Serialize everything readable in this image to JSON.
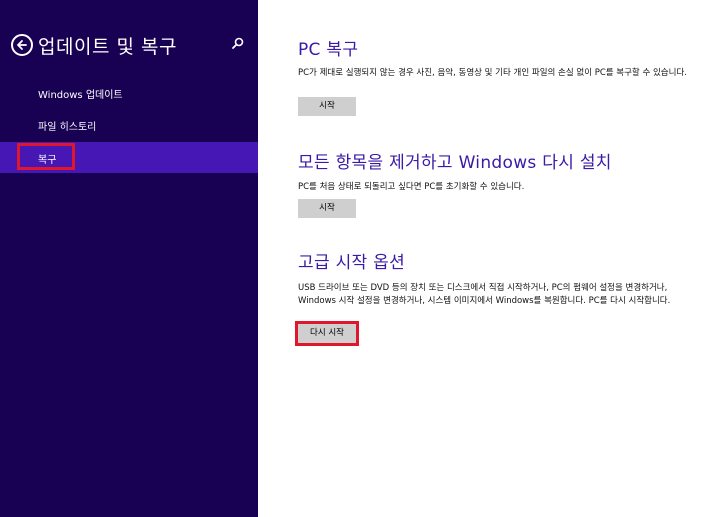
{
  "sidebar": {
    "title": "업데이트 및 복구",
    "items": [
      {
        "label": "Windows 업데이트"
      },
      {
        "label": "파일 히스토리"
      },
      {
        "label": "복구"
      }
    ]
  },
  "main": {
    "sections": [
      {
        "title": "PC 복구",
        "description": "PC가 제대로 실행되지 않는 경우 사진, 음악, 동영상 및 기타 개인 파일의 손실 없이 PC를 복구할 수 있습니다.",
        "button": "시작"
      },
      {
        "title": "모든 항목을 제거하고 Windows 다시 설치",
        "description": "PC를 처음 상태로 되돌리고 싶다면 PC를 초기화할 수 있습니다.",
        "button": "시작"
      },
      {
        "title": "고급 시작 옵션",
        "description": "USB 드라이브 또는 DVD 등의 장치 또는 디스크에서 직접 시작하거나, PC의 펌웨어 설정을 변경하거나, Windows 시작 설정을 변경하거나, 시스템 이미지에서 Windows를 복원합니다. PC를 다시 시작합니다.",
        "button": "다시 시작"
      }
    ]
  },
  "colors": {
    "sidebar_bg": "#180052",
    "active_item_bg": "#4617b4",
    "title_color": "#3a1aa6",
    "highlight_border": "#e0172c",
    "button_bg": "#cfcfcf"
  },
  "icons": {
    "back": "back-arrow-circle-icon",
    "search": "magnifier-icon"
  }
}
